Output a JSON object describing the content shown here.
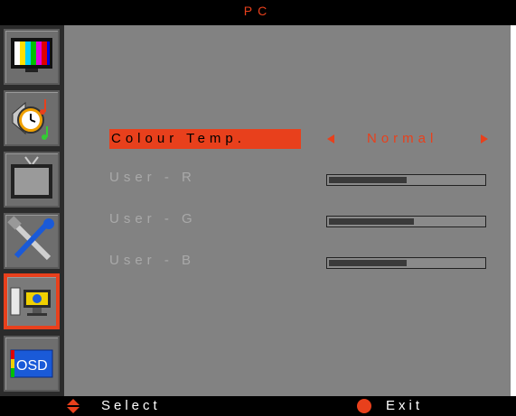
{
  "header": {
    "title": "PC"
  },
  "menu": {
    "rows": [
      {
        "label": "Colour Temp.",
        "value": "Normal",
        "selected": true
      },
      {
        "label": "User - R",
        "level": 0.5
      },
      {
        "label": "User - G",
        "level": 0.55
      },
      {
        "label": "User - B",
        "level": 0.5
      }
    ]
  },
  "sidebar": {
    "items": [
      {
        "icon": "picture-icon"
      },
      {
        "icon": "audio-clock-icon"
      },
      {
        "icon": "tv-icon"
      },
      {
        "icon": "tools-icon"
      },
      {
        "icon": "pc-icon",
        "active": true
      },
      {
        "icon": "osd-icon",
        "label": "OSD"
      }
    ]
  },
  "footer": {
    "select_label": "Select",
    "exit_label": "Exit"
  },
  "colors": {
    "accent": "#e8401c",
    "panel": "#828282",
    "sidebar": "#2b2b2b"
  }
}
